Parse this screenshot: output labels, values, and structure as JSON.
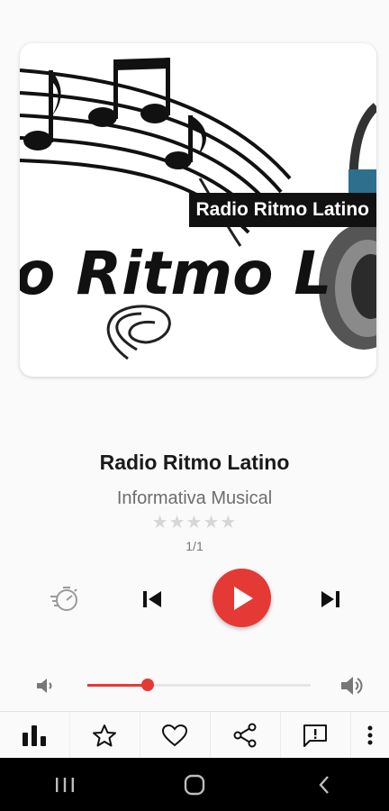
{
  "artwork": {
    "caption": "Radio Ritmo Latino",
    "logo_text": "o Ritmo L"
  },
  "station": {
    "name": "Radio Ritmo Latino",
    "genre": "Informativa Musical",
    "rating_stars": "★★★★★",
    "rating_value": 0,
    "counter": "1/1"
  },
  "controls": {
    "timer_icon": "sleep-timer-icon",
    "previous_icon": "skip-previous-icon",
    "play_icon": "play-icon",
    "next_icon": "skip-next-icon"
  },
  "volume": {
    "level": 0.27,
    "low_icon": "volume-low-icon",
    "high_icon": "volume-high-icon"
  },
  "toolbar": {
    "items": [
      "equalizer-icon",
      "star-icon",
      "heart-icon",
      "share-icon",
      "feedback-icon",
      "more-vert-icon"
    ]
  },
  "colors": {
    "accent": "#e53935",
    "background": "#fafafa",
    "text_primary": "#1a1a1a",
    "text_secondary": "#6d6d6d"
  }
}
